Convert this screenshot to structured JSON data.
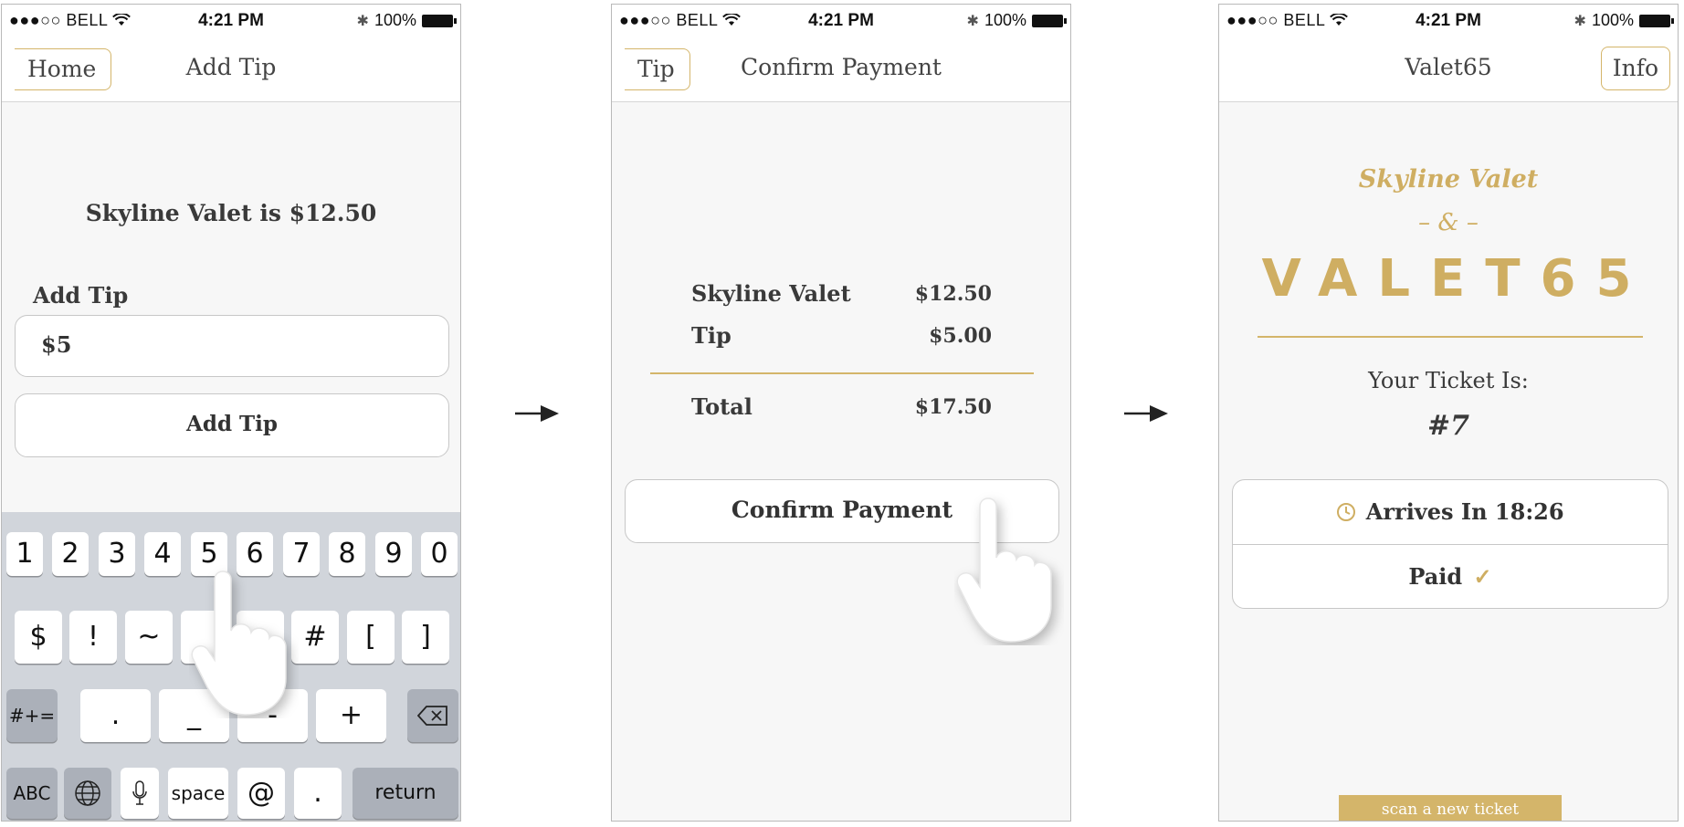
{
  "status_bar": {
    "carrier": "●●●○○ BELL",
    "time": "4:21 PM",
    "battery": "100%"
  },
  "screen1": {
    "back_label": "Home",
    "title": "Add Tip",
    "headline": "Skyline Valet is $12.50",
    "tip_label": "Add Tip",
    "tip_value": "$5",
    "add_tip_button": "Add Tip",
    "keyboard": {
      "row1": [
        "1",
        "2",
        "3",
        "4",
        "5",
        "6",
        "7",
        "8",
        "9",
        "0"
      ],
      "row2": [
        "$",
        "!",
        "~",
        "",
        "",
        "#",
        "[",
        "]"
      ],
      "row3": [
        ".",
        "_",
        "-",
        "+"
      ],
      "mode_key": "#+=",
      "abc_key": "ABC",
      "space_key": "space",
      "at_key": "@",
      "period_key": ".",
      "return_key": "return"
    }
  },
  "screen2": {
    "back_label": "Tip",
    "title": "Confirm Payment",
    "rows": [
      {
        "label": "Skyline Valet",
        "value": "$12.50"
      },
      {
        "label": "Tip",
        "value": "$5.00"
      }
    ],
    "total_label": "Total",
    "total_value": "$17.50",
    "confirm_button": "Confirm Payment"
  },
  "screen3": {
    "title": "Valet65",
    "info_button": "Info",
    "brand": "Skyline Valet",
    "ampersand": "– & –",
    "logo": "VALET65",
    "ticket_label": "Your Ticket Is:",
    "ticket_number": "#7",
    "arrives_text": "Arrives In 18:26",
    "paid_text": "Paid",
    "paid_mark": "✓",
    "scan_button": "scan a new ticket"
  },
  "colors": {
    "accent_gold": "#d4b56a",
    "text_dark": "#333333",
    "keyboard_bg": "#d1d5db"
  },
  "icons": [
    "wifi-icon",
    "bluetooth-icon",
    "battery-icon",
    "back-chevron-icon",
    "delete-key-icon",
    "globe-icon",
    "microphone-icon",
    "clock-icon",
    "checkmark-icon",
    "arrow-right-icon",
    "hand-pointer-icon"
  ]
}
